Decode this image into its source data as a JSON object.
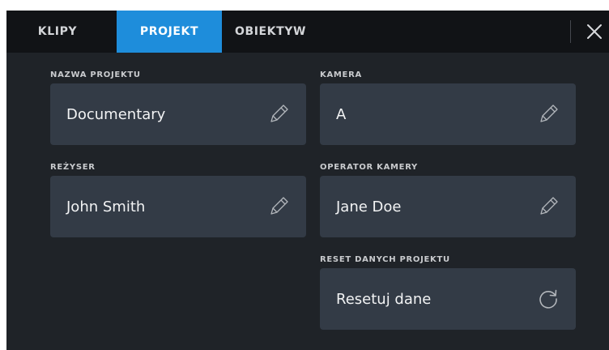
{
  "tabs": [
    {
      "label": "KLIPY",
      "active": false
    },
    {
      "label": "PROJEKT",
      "active": true
    },
    {
      "label": "OBIEKTYW",
      "active": false
    }
  ],
  "close_icon": "close-icon",
  "fields": {
    "project_name": {
      "label": "NAZWA PROJEKTU",
      "value": "Documentary",
      "icon": "pencil-icon"
    },
    "camera": {
      "label": "KAMERA",
      "value": "A",
      "icon": "pencil-icon"
    },
    "director": {
      "label": "REŻYSER",
      "value": "John Smith",
      "icon": "pencil-icon"
    },
    "camera_operator": {
      "label": "OPERATOR KAMERY",
      "value": "Jane Doe",
      "icon": "pencil-icon"
    },
    "reset": {
      "label": "RESET DANYCH PROJEKTU",
      "value": "Resetuj dane",
      "icon": "refresh-icon"
    }
  },
  "colors": {
    "background": "#1f2328",
    "tab_bar": "#111316",
    "active_tab": "#1e8ddb",
    "field": "#333b46"
  }
}
